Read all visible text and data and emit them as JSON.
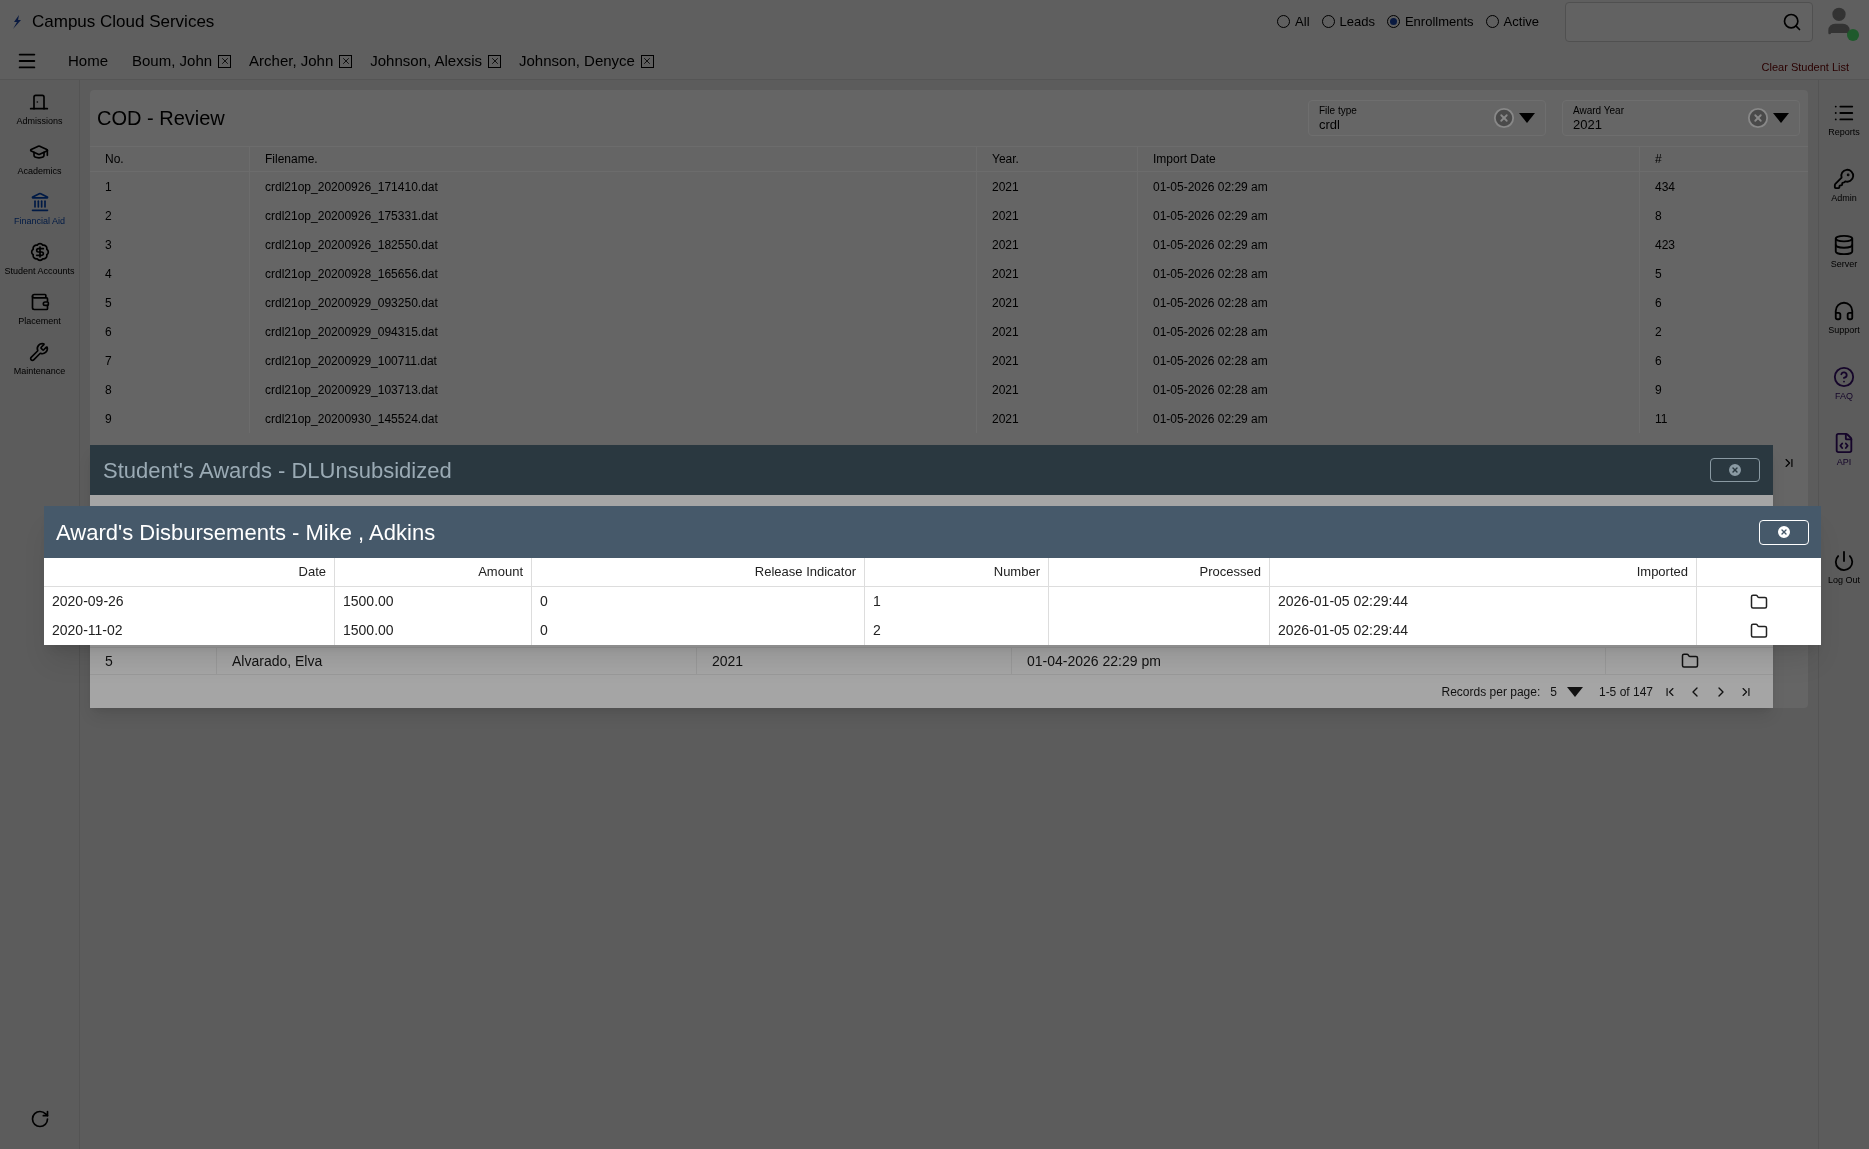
{
  "app": {
    "title": "Campus Cloud Services"
  },
  "filters": [
    {
      "label": "All",
      "selected": false
    },
    {
      "label": "Leads",
      "selected": false
    },
    {
      "label": "Enrollments",
      "selected": true
    },
    {
      "label": "Active",
      "selected": false
    }
  ],
  "nav_tabs": [
    {
      "label": "Home",
      "kind": "home"
    },
    {
      "label": "Boum, John",
      "kind": "student"
    },
    {
      "label": "Archer, John",
      "kind": "student"
    },
    {
      "label": "Johnson, Alexsis",
      "kind": "student"
    },
    {
      "label": "Johnson, Denyce",
      "kind": "student"
    }
  ],
  "clear_link": "Clear Student List",
  "left_sidebar": {
    "items": [
      {
        "label": "Admissions",
        "kind": "door",
        "selected": false
      },
      {
        "label": "Academics",
        "kind": "cap",
        "selected": false
      },
      {
        "label": "Financial Aid",
        "kind": "bank",
        "selected": true
      },
      {
        "label": "Student Accounts",
        "kind": "money",
        "selected": false
      },
      {
        "label": "Placement",
        "kind": "wallet",
        "selected": false
      },
      {
        "label": "Maintenance",
        "kind": "tools",
        "selected": false
      }
    ]
  },
  "right_sidebar": {
    "items": [
      {
        "label": "Reports",
        "kind": "list"
      },
      {
        "label": "Admin",
        "kind": "key"
      },
      {
        "label": "Server",
        "kind": "database"
      },
      {
        "label": "Support",
        "kind": "headphones"
      },
      {
        "label": "FAQ",
        "kind": "help"
      },
      {
        "label": "API",
        "kind": "code"
      },
      {
        "label": "Log Out",
        "kind": "power"
      }
    ]
  },
  "page": {
    "title": "COD - Review",
    "file_type": {
      "label": "File type",
      "value": "crdl"
    },
    "award_year": {
      "label": "Award Year",
      "value": "2021"
    },
    "table": {
      "columns": [
        "No.",
        "Filename.",
        "Year.",
        "Import Date",
        "#"
      ],
      "rows": [
        [
          "1",
          "crdl21op_20200926_171410.dat",
          "2021",
          "01-05-2026 02:29 am",
          "434"
        ],
        [
          "2",
          "crdl21op_20200926_175331.dat",
          "2021",
          "01-05-2026 02:29 am",
          "8"
        ],
        [
          "3",
          "crdl21op_20200926_182550.dat",
          "2021",
          "01-05-2026 02:29 am",
          "423"
        ],
        [
          "4",
          "crdl21op_20200928_165656.dat",
          "2021",
          "01-05-2026 02:28 am",
          "5"
        ],
        [
          "5",
          "crdl21op_20200929_093250.dat",
          "2021",
          "01-05-2026 02:28 am",
          "6"
        ],
        [
          "6",
          "crdl21op_20200929_094315.dat",
          "2021",
          "01-05-2026 02:28 am",
          "2"
        ],
        [
          "7",
          "crdl21op_20200929_100711.dat",
          "2021",
          "01-05-2026 02:28 am",
          "6"
        ],
        [
          "8",
          "crdl21op_20200929_103713.dat",
          "2021",
          "01-05-2026 02:28 am",
          "9"
        ],
        [
          "9",
          "crdl21op_20200930_145524.dat",
          "2021",
          "01-05-2026 02:29 am",
          "11"
        ]
      ]
    }
  },
  "awards_modal": {
    "title": "Student's Awards - DLUnsubsidized",
    "rows": [
      [
        "5",
        "Alvarado, Elva",
        "2021",
        "01-04-2026 22:29 pm"
      ]
    ],
    "pagination": {
      "label": "Records per page:",
      "per_page": "5",
      "range": "1-5 of 147"
    }
  },
  "disbursements_modal": {
    "title": "Award's Disbursements - Mike , Adkins",
    "columns": [
      "Date",
      "Amount",
      "Release Indicator",
      "Number",
      "Processed",
      "Imported"
    ],
    "rows": [
      [
        "2020-09-26",
        "1500.00",
        "0",
        "1",
        "",
        "2026-01-05 02:29:44"
      ],
      [
        "2020-11-02",
        "1500.00",
        "0",
        "2",
        "",
        "2026-01-05 02:29:44"
      ]
    ]
  }
}
